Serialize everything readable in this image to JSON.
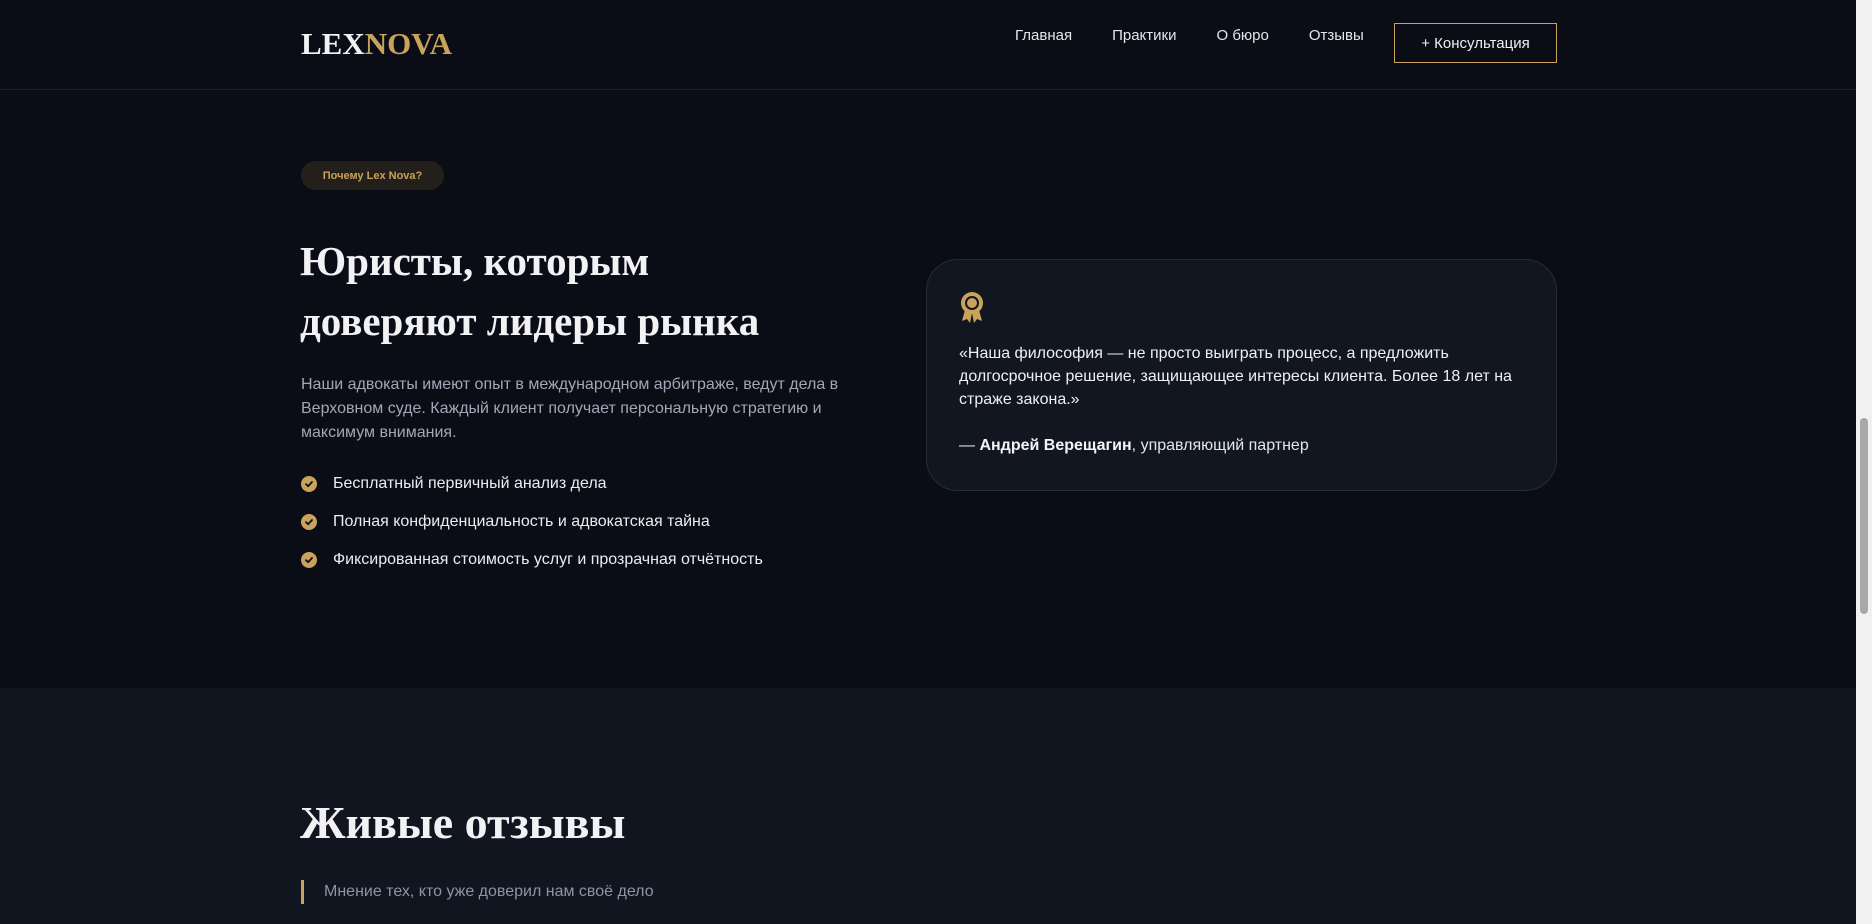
{
  "header": {
    "logo_lex": "LEX",
    "logo_nova": "NOVA",
    "nav": [
      "Главная",
      "Практики",
      "О бюро",
      "Отзывы"
    ],
    "cta_label": "+ Консультация"
  },
  "why": {
    "badge": "Почему Lex Nova?",
    "headline_line1": "Юристы, которым",
    "headline_line2": "доверяют лидеры рынка",
    "lead": "Наши адвокаты имеют опыт в международном арбитраже, ведут дела в Верховном суде. Каждый клиент получает персональную стратегию и максимум внимания.",
    "features": [
      "Бесплатный первичный анализ дела",
      "Полная конфиденциальность и адвокатская тайна",
      "Фиксированная стоимость услуг и прозрачная отчётность"
    ]
  },
  "quote": {
    "text": "«Наша философия — не просто выиграть процесс, а предложить долгосрочное решение, защищающее интересы клиента. Более 18 лет на страже закона.»",
    "author_prefix": "— ",
    "author_name": "Андрей Верещагин",
    "author_role": ", управляющий партнер"
  },
  "reviews": {
    "title": "Живые отзывы",
    "subtitle": "Мнение тех, кто уже доверил нам своё дело"
  },
  "colors": {
    "accent": "#c9a25c",
    "background": "#0b0d16",
    "card": "#121621",
    "section_alt": "#111520"
  }
}
